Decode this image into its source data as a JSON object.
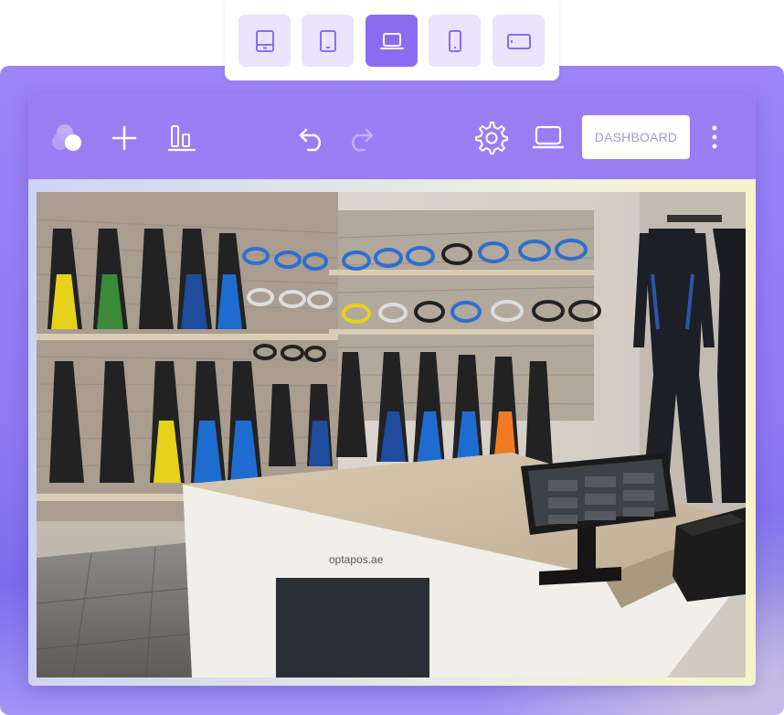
{
  "device_switcher": {
    "items": [
      {
        "icon": "tablet-landscape-icon",
        "active": false
      },
      {
        "icon": "tablet-icon",
        "active": false
      },
      {
        "icon": "laptop-icon",
        "active": true
      },
      {
        "icon": "phone-icon",
        "active": false
      },
      {
        "icon": "tablet-horizontal-icon",
        "active": false
      }
    ]
  },
  "toolbar": {
    "icons": [
      "logo-icon",
      "add-icon",
      "align-bottom-icon",
      "undo-icon",
      "redo-icon",
      "settings-icon",
      "laptop-preview-icon",
      "more-vertical-icon"
    ],
    "dashboard_label": "DASHBOARD"
  },
  "canvas": {
    "image_caption": "optapos.ae"
  },
  "colors": {
    "accent": "#9b7df3",
    "accent_light": "#e9e4fc",
    "active": "#8a6cf1"
  }
}
